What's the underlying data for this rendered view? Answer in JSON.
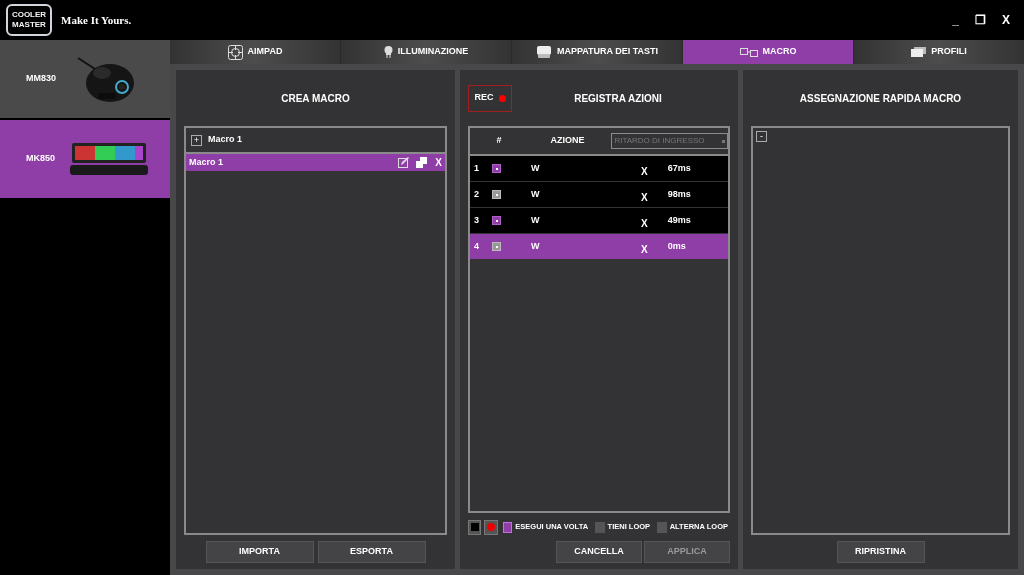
{
  "app": {
    "logo": "COOLER MASTER",
    "slogan": "Make It Yours.",
    "window_controls": [
      "_",
      "❐",
      "X"
    ]
  },
  "devices": [
    {
      "name": "MM830",
      "kind": "mouse",
      "selected": false
    },
    {
      "name": "MK850",
      "kind": "keyboard",
      "selected": true
    }
  ],
  "tabs": [
    {
      "label": "AIMPAD",
      "kind": "target",
      "selected": false
    },
    {
      "label": "ILLUMINAZIONE",
      "kind": "bulb",
      "selected": false
    },
    {
      "label": "MAPPATURA DEI TASTI",
      "kind": "keys",
      "selected": false
    },
    {
      "label": "MACRO",
      "kind": "macro",
      "selected": true
    },
    {
      "label": "PROFILI",
      "kind": "cards",
      "selected": false
    }
  ],
  "create_macro": {
    "title": "CREA MACRO",
    "add_label": "Macro 1",
    "add_symbol": "+",
    "macros": [
      {
        "name": "Macro 1",
        "selected": true,
        "delete": "X"
      }
    ],
    "buttons": [
      "IMPORTA",
      "ESPORTA"
    ]
  },
  "record": {
    "rec_label": "REC",
    "title": "REGISTRA AZIONI",
    "columns": [
      "#",
      "AZIONE"
    ],
    "delay_dropdown": {
      "placeholder": "RITARDO DI INGRESSO"
    },
    "rows": [
      {
        "index": "1",
        "kind": "down",
        "action": "W",
        "delete": "X",
        "delay": "67ms",
        "selected": false
      },
      {
        "index": "2",
        "kind": "up",
        "action": "W",
        "delete": "X",
        "delay": "98ms",
        "selected": false
      },
      {
        "index": "3",
        "kind": "down",
        "action": "W",
        "delete": "X",
        "delay": "49ms",
        "selected": false
      },
      {
        "index": "4",
        "kind": "up",
        "action": "W",
        "delete": "X",
        "delay": "0ms",
        "selected": true
      }
    ],
    "modes": [
      {
        "label": "ESEGUI UNA VOLTA",
        "selected": true
      },
      {
        "label": "TIENI LOOP",
        "selected": false
      },
      {
        "label": "ALTERNA LOOP",
        "selected": false
      }
    ],
    "buttons": [
      {
        "label": "CANCELLA",
        "disabled": false
      },
      {
        "label": "APPLICA",
        "disabled": true
      }
    ]
  },
  "quick_assign": {
    "title": "ASSEGNAZIONE RAPIDA MACRO",
    "collapse_symbol": "-",
    "buttons": [
      "RIPRISTINA"
    ]
  }
}
